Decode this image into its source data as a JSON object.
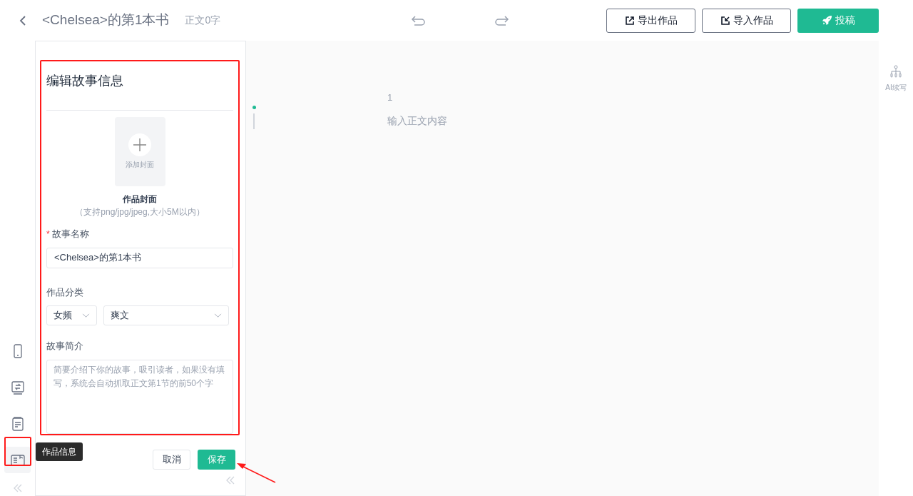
{
  "header": {
    "title": "<Chelsea>的第1本书",
    "word_count": "正文0字",
    "buttons": [
      {
        "label": "导出作品",
        "kind": "export"
      },
      {
        "label": "导入作品",
        "kind": "import"
      },
      {
        "label": "投稿",
        "kind": "submit"
      }
    ]
  },
  "left_rail": {
    "items": [
      {
        "kind": "phone",
        "selected": false
      },
      {
        "kind": "swap",
        "selected": false
      },
      {
        "kind": "doc",
        "selected": false
      },
      {
        "kind": "info",
        "selected": true
      }
    ],
    "tooltip": "作品信息"
  },
  "panel": {
    "title": "编辑故事信息",
    "cover": {
      "button_label": "添加封面",
      "label": "作品封面",
      "hint": "（支持png/jpg/jpeg,大小5M以内）"
    },
    "name_field": {
      "label": "故事名称",
      "required_mark": "*",
      "value": "<Chelsea>的第1本书"
    },
    "category": {
      "label": "作品分类",
      "selects": [
        "女频",
        "爽文"
      ]
    },
    "intro": {
      "label": "故事简介",
      "placeholder": "简要介绍下你的故事，吸引读者，如果没有填写，系统会自动抓取正文第1节的前50个字"
    },
    "buttons": [
      {
        "label": "取消",
        "kind": "secondary"
      },
      {
        "label": "保存",
        "kind": "primary"
      }
    ]
  },
  "editor": {
    "line_number": "1",
    "placeholder": "输入正文内容"
  },
  "right_rail": {
    "items": [
      {
        "label": "AI续写"
      }
    ]
  }
}
